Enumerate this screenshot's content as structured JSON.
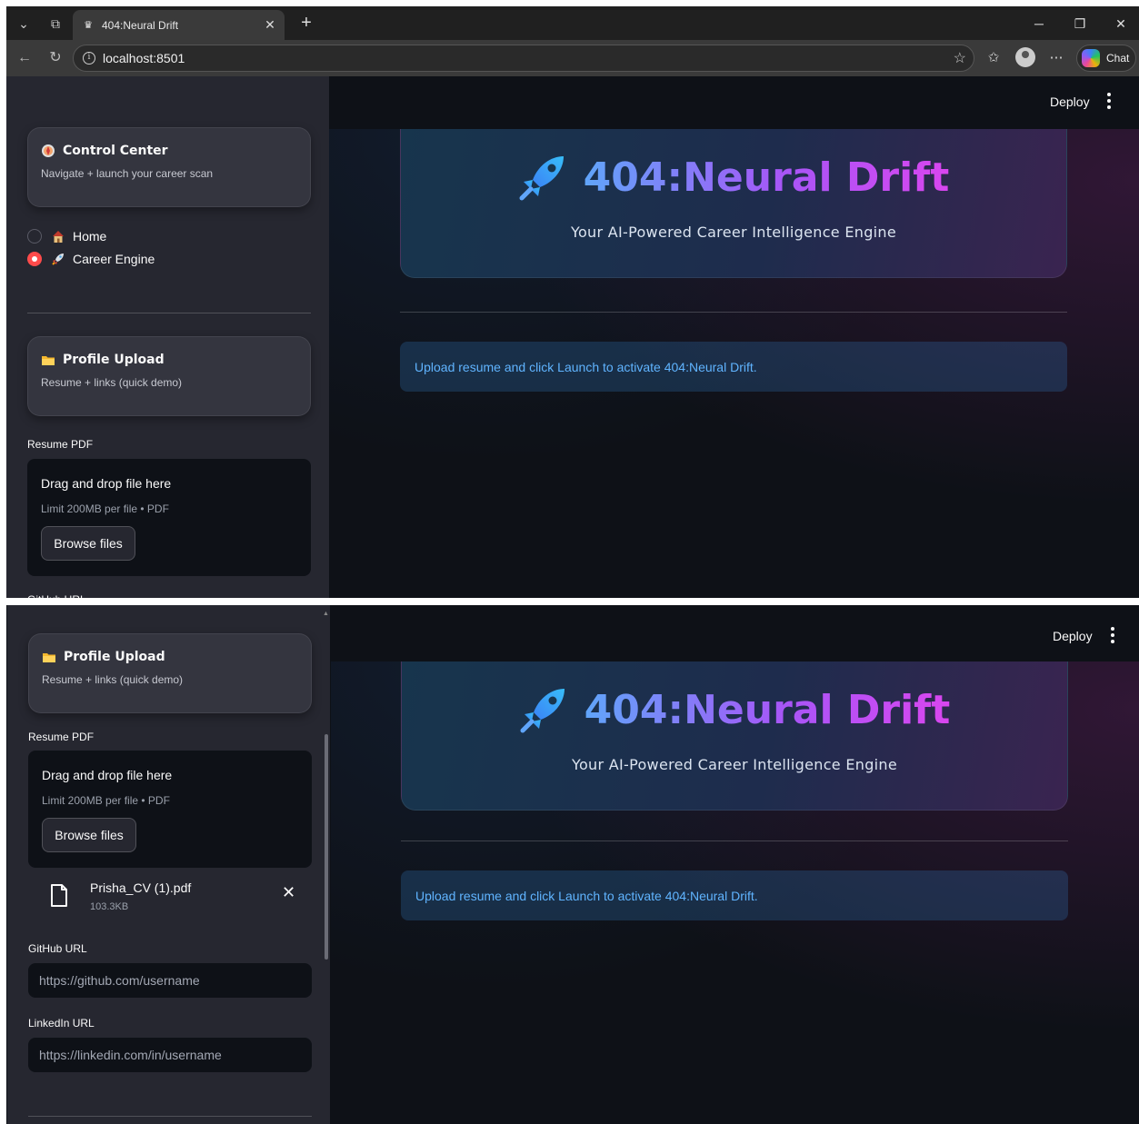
{
  "browser": {
    "tab_title": "404:Neural Drift",
    "url": "localhost:8501",
    "chat_label": "Chat"
  },
  "app": {
    "deploy_label": "Deploy",
    "hero_title": "404:Neural Drift",
    "hero_subtitle": "Your AI-Powered Career Intelligence Engine",
    "info_message": "Upload resume and click Launch to activate 404:Neural Drift."
  },
  "sidebar": {
    "control_center": {
      "title": "Control Center",
      "subtitle": "Navigate + launch your career scan"
    },
    "nav": [
      {
        "label": "Home",
        "selected": false,
        "icon": "house-emoji"
      },
      {
        "label": "Career Engine",
        "selected": true,
        "icon": "rocket-emoji"
      }
    ],
    "profile_upload": {
      "title": "Profile Upload",
      "subtitle": "Resume + links (quick demo)"
    },
    "resume_label": "Resume PDF",
    "dropzone": {
      "title": "Drag and drop file here",
      "limit": "Limit 200MB per file • PDF",
      "browse_label": "Browse files"
    },
    "uploaded_file": {
      "name": "Prisha_CV (1).pdf",
      "size": "103.3KB"
    },
    "github_label": "GitHub URL",
    "github_placeholder": "https://github.com/username",
    "linkedin_label": "LinkedIn URL",
    "linkedin_placeholder": "https://linkedin.com/in/username"
  },
  "colors": {
    "accent_red": "#ff4b4b",
    "info_text": "#60b4ff",
    "sidebar_bg": "#262730",
    "main_bg": "#0e1117"
  }
}
